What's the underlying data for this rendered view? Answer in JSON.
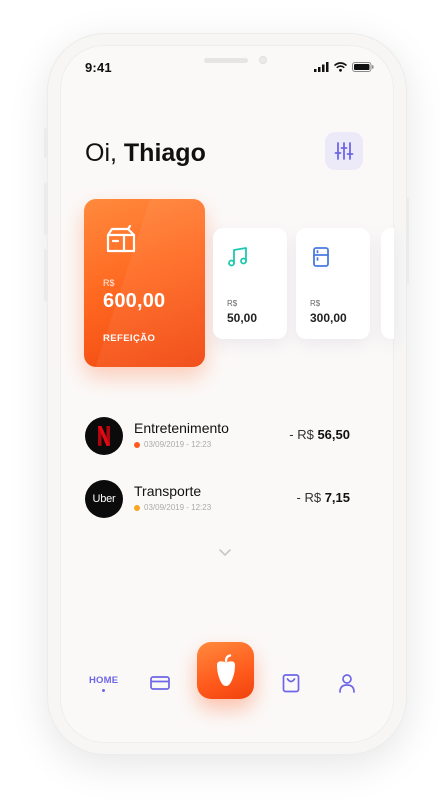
{
  "status_bar": {
    "time": "9:41"
  },
  "greeting": {
    "prefix": "Oi,",
    "name": "Thiago"
  },
  "colors": {
    "accent": "#6E66E6",
    "orange": "#FF6A22",
    "music_icon": "#1FC8B0",
    "fridge_icon": "#4A7BE0",
    "netflix_red": "#E50914"
  },
  "cards": {
    "main": {
      "currency": "R$",
      "amount": "600,00",
      "label": "REFEIÇÃO",
      "icon": "meal-bag-icon"
    },
    "music": {
      "currency": "R$",
      "amount": "50,00",
      "icon": "music-note-icon"
    },
    "fridge": {
      "currency": "R$",
      "amount": "300,00",
      "icon": "fridge-icon"
    }
  },
  "transactions": [
    {
      "category": "Entretenimento",
      "datetime": "03/09/2019 - 12:23",
      "prefix": "- R$",
      "amount": "56,50",
      "dot_color": "#FF5A1C",
      "logo": "netflix-logo"
    },
    {
      "category": "Transporte",
      "datetime": "03/09/2019 - 12:23",
      "prefix": "- R$",
      "amount": "7,15",
      "dot_color": "#F5A623",
      "logo_text": "Uber"
    }
  ],
  "nav": {
    "home": "HOME"
  }
}
